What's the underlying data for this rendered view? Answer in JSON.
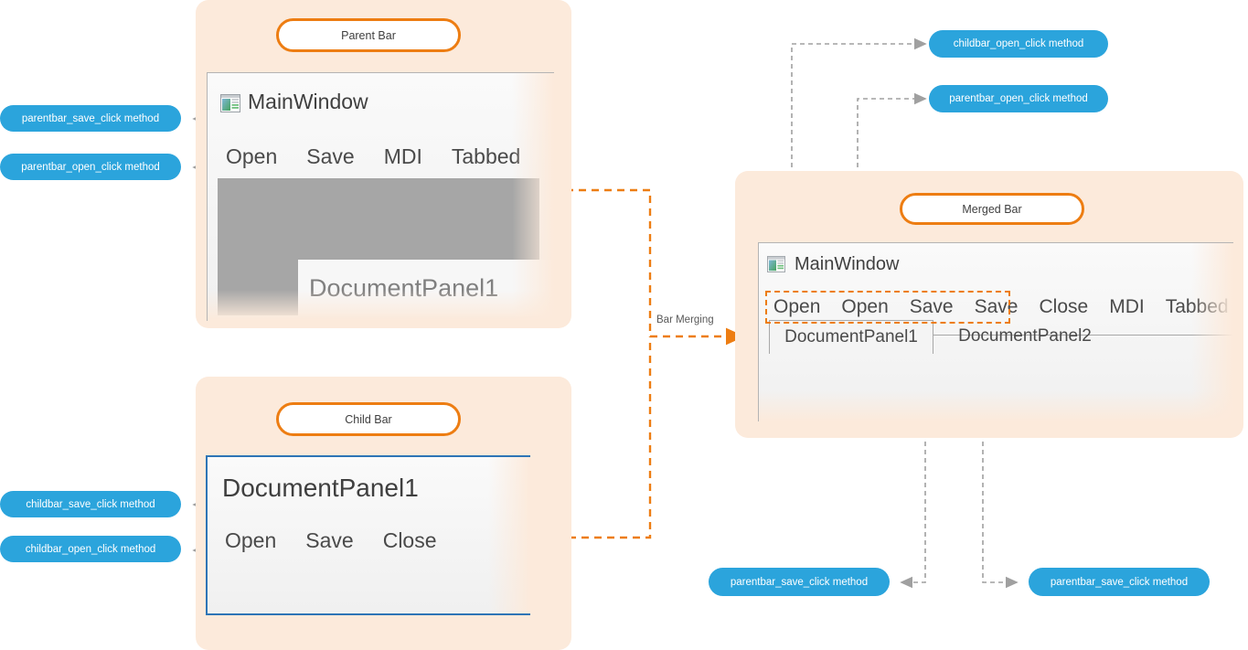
{
  "groups": {
    "parent": {
      "badge_label": "Parent Bar",
      "window": {
        "title": "MainWindow",
        "icon": "window-app-icon",
        "menu_items": [
          "Open",
          "Save",
          "MDI",
          "Tabbed"
        ],
        "document_overlay": "DocumentPanel1"
      }
    },
    "child": {
      "badge_label": "Child Bar",
      "window": {
        "title": "DocumentPanel1",
        "menu_items": [
          "Open",
          "Save",
          "Close"
        ]
      }
    },
    "merged": {
      "badge_label": "Merged Bar",
      "window": {
        "title": "MainWindow",
        "icon": "window-app-icon",
        "menu_items": [
          "Open",
          "Open",
          "Save",
          "Save",
          "Close",
          "MDI",
          "Tabbed"
        ],
        "tabs": [
          {
            "label": "DocumentPanel1",
            "active": true
          },
          {
            "label": "DocumentPanel2",
            "active": false
          }
        ]
      }
    }
  },
  "flow": {
    "merge_label": "Bar Merging"
  },
  "callouts": {
    "parent_save": "parentbar_save_click method",
    "parent_open": "parentbar_open_click method",
    "child_save": "childbar_save_click method",
    "child_open": "childbar_open_click method",
    "merged_open_child": "childbar_open_click method",
    "merged_open_parent": "parentbar_open_click method",
    "merged_save_left": "parentbar_save_click method",
    "merged_save_right": "parentbar_save_click method"
  },
  "colors": {
    "panel_bg": "#FCEADB",
    "accent_orange": "#ED7D12",
    "callout_blue": "#2BA4DC",
    "connector_gray": "#A0A0A0",
    "child_border_blue": "#2E75B6"
  }
}
